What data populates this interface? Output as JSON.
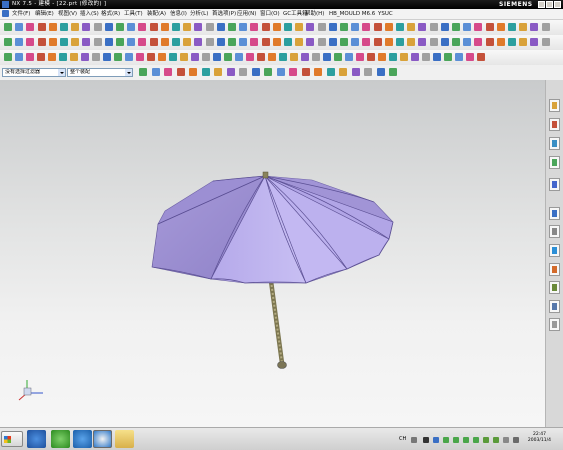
{
  "titlebar": {
    "title": "NX 7.5 - 建模 - [22.prt  (修改的)  ]",
    "brand": "SIEMENS"
  },
  "menu": [
    "文件(F)",
    "编辑(E)",
    "视图(V)",
    "插入(S)",
    "格式(R)",
    "工具(T)",
    "装配(A)",
    "信息(I)",
    "分析(L)",
    "首选项(P)",
    "应用(N)",
    "窗口(O)",
    "GC工具箱",
    "帮助(H)",
    "HB_MOULD M6.6",
    "YSUC"
  ],
  "selection_bar": {
    "type_filter": "没有选择过滤器",
    "scope": "整个装配"
  },
  "tray": {
    "lang": "CH"
  },
  "clock": {
    "time": "22:47",
    "date": "2003/11/4"
  },
  "icons": {
    "titlebar": [
      "app-icon",
      "minimize-icon",
      "maximize-icon",
      "close-icon"
    ],
    "resource_bar": [
      "assembly-navigator-icon",
      "constraint-navigator-icon",
      "part-navigator-icon",
      "reuse-library-icon",
      "hd3d-tools-icon",
      "web-browser-icon",
      "history-icon",
      "system-materials-icon",
      "process-studio-icon",
      "roles-icon",
      "system-scenes-icon",
      "training-icon"
    ],
    "taskbar": [
      "bird-icon",
      "refresh-icon",
      "s-app-icon",
      "ie-icon",
      "folder-icon"
    ]
  },
  "colors": {
    "canopy": "#a699d8",
    "canopy_light": "#c2b7ef",
    "canopy_dark": "#8d80c6",
    "shaft": "#a49c73"
  }
}
